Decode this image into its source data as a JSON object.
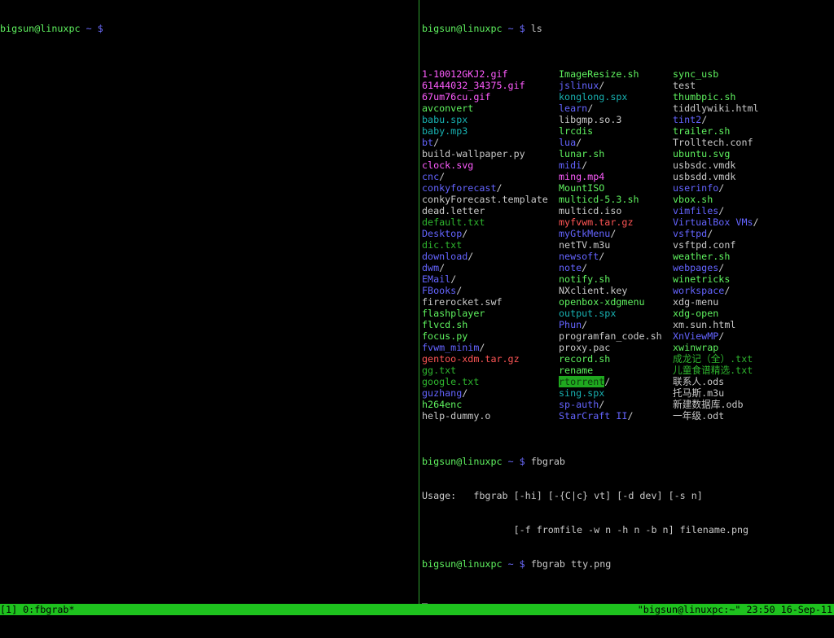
{
  "left_pane": {
    "prompt_user": "bigsun@linuxpc",
    "prompt_tilde": "~",
    "prompt_dollar": "$"
  },
  "right_pane": {
    "prompt_user": "bigsun@linuxpc",
    "prompt_tilde": "~",
    "prompt_dollar": "$",
    "cmd_ls": "ls",
    "ls_columns": [
      [
        {
          "name": "1-10012GKJ2.gif",
          "color": "magenta",
          "slash": false
        },
        {
          "name": "61444032_34375.gif",
          "color": "magenta",
          "slash": false
        },
        {
          "name": "67um76cu.gif",
          "color": "magenta",
          "slash": false
        },
        {
          "name": "avconvert",
          "color": "green",
          "slash": false
        },
        {
          "name": "babu.spx",
          "color": "cyan",
          "slash": false
        },
        {
          "name": "baby.mp3",
          "color": "cyan",
          "slash": false
        },
        {
          "name": "bt",
          "color": "blue",
          "slash": true
        },
        {
          "name": "build-wallpaper.py",
          "color": "white",
          "slash": false
        },
        {
          "name": "clock.svg",
          "color": "magenta",
          "slash": false
        },
        {
          "name": "cnc",
          "color": "blue",
          "slash": true
        },
        {
          "name": "conkyforecast",
          "color": "blue",
          "slash": true
        },
        {
          "name": "conkyForecast.template",
          "color": "white",
          "slash": false
        },
        {
          "name": "dead.letter",
          "color": "white",
          "slash": false
        },
        {
          "name": "default.txt",
          "color": "dimgreen",
          "slash": false
        },
        {
          "name": "Desktop",
          "color": "blue",
          "slash": true
        },
        {
          "name": "dic.txt",
          "color": "dimgreen",
          "slash": false
        },
        {
          "name": "download",
          "color": "blue",
          "slash": true
        },
        {
          "name": "dwm",
          "color": "blue",
          "slash": true
        },
        {
          "name": "EMail",
          "color": "blue",
          "slash": true
        },
        {
          "name": "FBooks",
          "color": "blue",
          "slash": true
        },
        {
          "name": "firerocket.swf",
          "color": "white",
          "slash": false
        },
        {
          "name": "flashplayer",
          "color": "green",
          "slash": false
        },
        {
          "name": "flvcd.sh",
          "color": "green",
          "slash": false
        },
        {
          "name": "focus.py",
          "color": "green",
          "slash": false
        },
        {
          "name": "fvwm_minim",
          "color": "blue",
          "slash": true
        },
        {
          "name": "gentoo-xdm.tar.gz",
          "color": "red",
          "slash": false
        },
        {
          "name": "gg.txt",
          "color": "dimgreen",
          "slash": false
        },
        {
          "name": "google.txt",
          "color": "dimgreen",
          "slash": false
        },
        {
          "name": "guzhang",
          "color": "blue",
          "slash": true
        },
        {
          "name": "h264enc",
          "color": "green",
          "slash": false
        },
        {
          "name": "help-dummy.o",
          "color": "white",
          "slash": false
        }
      ],
      [
        {
          "name": "ImageResize.sh",
          "color": "green",
          "slash": false
        },
        {
          "name": "jslinux",
          "color": "blue",
          "slash": true
        },
        {
          "name": "konglong.spx",
          "color": "cyan",
          "slash": false
        },
        {
          "name": "learn",
          "color": "blue",
          "slash": true
        },
        {
          "name": "libgmp.so.3",
          "color": "white",
          "slash": false
        },
        {
          "name": "lrcdis",
          "color": "green",
          "slash": false
        },
        {
          "name": "lua",
          "color": "blue",
          "slash": true
        },
        {
          "name": "lunar.sh",
          "color": "green",
          "slash": false
        },
        {
          "name": "midi",
          "color": "blue",
          "slash": true
        },
        {
          "name": "ming.mp4",
          "color": "magenta",
          "slash": false
        },
        {
          "name": "MountISO",
          "color": "green",
          "slash": false
        },
        {
          "name": "multicd-5.3.sh",
          "color": "green",
          "slash": false
        },
        {
          "name": "multicd.iso",
          "color": "white",
          "slash": false
        },
        {
          "name": "myfvwm.tar.gz",
          "color": "red",
          "slash": false
        },
        {
          "name": "myGtkMenu",
          "color": "blue",
          "slash": true
        },
        {
          "name": "netTV.m3u",
          "color": "white",
          "slash": false
        },
        {
          "name": "newsoft",
          "color": "blue",
          "slash": true
        },
        {
          "name": "note",
          "color": "blue",
          "slash": true
        },
        {
          "name": "notify.sh",
          "color": "green",
          "slash": false
        },
        {
          "name": "NXclient.key",
          "color": "white",
          "slash": false
        },
        {
          "name": "openbox-xdgmenu",
          "color": "green",
          "slash": false
        },
        {
          "name": "output.spx",
          "color": "cyan",
          "slash": false
        },
        {
          "name": "Phun",
          "color": "blue",
          "slash": true
        },
        {
          "name": "programfan_code.sh",
          "color": "white",
          "slash": false
        },
        {
          "name": "proxy.pac",
          "color": "white",
          "slash": false
        },
        {
          "name": "record.sh",
          "color": "green",
          "slash": false
        },
        {
          "name": "rename",
          "color": "green",
          "slash": false
        },
        {
          "name": "rtorrent",
          "color": "highlight",
          "slash": true
        },
        {
          "name": "sing.spx",
          "color": "cyan",
          "slash": false
        },
        {
          "name": "sp-auth",
          "color": "blue",
          "slash": true
        },
        {
          "name": "StarCraft II",
          "color": "blue",
          "slash": true
        }
      ],
      [
        {
          "name": "sync_usb",
          "color": "green",
          "slash": false
        },
        {
          "name": "test",
          "color": "white",
          "slash": false
        },
        {
          "name": "thumbpic.sh",
          "color": "green",
          "slash": false
        },
        {
          "name": "tiddlywiki.html",
          "color": "white",
          "slash": false
        },
        {
          "name": "tint2",
          "color": "blue",
          "slash": true
        },
        {
          "name": "trailer.sh",
          "color": "green",
          "slash": false
        },
        {
          "name": "Trolltech.conf",
          "color": "white",
          "slash": false
        },
        {
          "name": "ubuntu.svg",
          "color": "green",
          "slash": false
        },
        {
          "name": "usbsdc.vmdk",
          "color": "white",
          "slash": false
        },
        {
          "name": "usbsdd.vmdk",
          "color": "white",
          "slash": false
        },
        {
          "name": "userinfo",
          "color": "blue",
          "slash": true
        },
        {
          "name": "vbox.sh",
          "color": "green",
          "slash": false
        },
        {
          "name": "vimfiles",
          "color": "blue",
          "slash": true
        },
        {
          "name": "VirtualBox VMs",
          "color": "blue",
          "slash": true
        },
        {
          "name": "vsftpd",
          "color": "blue",
          "slash": true
        },
        {
          "name": "vsftpd.conf",
          "color": "white",
          "slash": false
        },
        {
          "name": "weather.sh",
          "color": "green",
          "slash": false
        },
        {
          "name": "webpages",
          "color": "blue",
          "slash": true
        },
        {
          "name": "winetricks",
          "color": "green",
          "slash": false
        },
        {
          "name": "workspace",
          "color": "blue",
          "slash": true
        },
        {
          "name": "xdg-menu",
          "color": "white",
          "slash": false
        },
        {
          "name": "xdg-open",
          "color": "green",
          "slash": false
        },
        {
          "name": "xm.sun.html",
          "color": "white",
          "slash": false
        },
        {
          "name": "XnViewMP",
          "color": "blue",
          "slash": true
        },
        {
          "name": "xwinwrap",
          "color": "green",
          "slash": false
        },
        {
          "name": "成龙记（全）.txt",
          "color": "dimgreen",
          "slash": false
        },
        {
          "name": "儿童食谱精选.txt",
          "color": "dimgreen",
          "slash": false
        },
        {
          "name": "联系人.ods",
          "color": "white",
          "slash": false
        },
        {
          "name": "托马斯.m3u",
          "color": "white",
          "slash": false
        },
        {
          "name": "新建数据库.odb",
          "color": "white",
          "slash": false
        },
        {
          "name": "一年级.odt",
          "color": "white",
          "slash": false
        }
      ]
    ],
    "cmd_fbgrab": "fbgrab",
    "usage_line_1": "Usage:   fbgrab [-hi] [-{C|c} vt] [-d dev] [-s n]",
    "usage_line_2": "                [-f fromfile -w n -h n -b n] filename.png",
    "cmd_fbgrab_png": "fbgrab tty.png",
    "cursor": "_"
  },
  "status_bar": {
    "left": "[1] 0:fbgrab*",
    "right": "\"bigsun@linuxpc:~\" 23:50 16-Sep-11"
  },
  "colors": {
    "magenta": "#ff5cff",
    "blue": "#6464ff",
    "green": "#5ff25f",
    "white": "#c9c9c9",
    "cyan": "#18b2b2",
    "red": "#ff5555",
    "dimgreen": "#2eb52e",
    "status_bar": "#1ec21e",
    "divider": "#2ea12e"
  }
}
